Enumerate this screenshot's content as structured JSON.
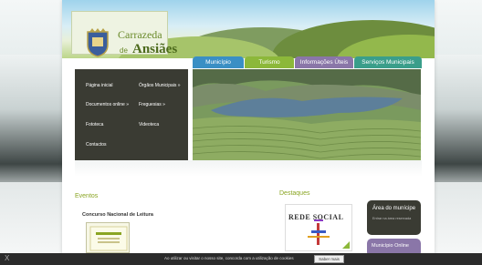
{
  "site": {
    "logo_line1": "Carrazeda",
    "logo_de": "de",
    "logo_line2": "Ansiães"
  },
  "nav": {
    "items": [
      {
        "label": "Município",
        "color": "#3a8fc4"
      },
      {
        "label": "Turismo",
        "color": "#8cb83a"
      },
      {
        "label": "Informações Úteis",
        "color": "#8a76a8"
      },
      {
        "label": "Serviços Municipais",
        "color": "#3a9e8a"
      }
    ]
  },
  "menu": {
    "items": [
      {
        "label": "Página inicial"
      },
      {
        "label": "Órgãos Municipais »"
      },
      {
        "label": "Documentos online »"
      },
      {
        "label": "Freguesias »"
      },
      {
        "label": "Fototeca"
      },
      {
        "label": "Videoteca"
      },
      {
        "label": "Contactos"
      }
    ]
  },
  "eventos": {
    "title": "Eventos",
    "item_title": "Concurso Nacional de Leitura"
  },
  "destaques": {
    "title": "Destaques",
    "rede_social_label": "REDE SOCIAL",
    "area_title": "Área do munícipe",
    "area_sub": "Entrar na área reservada",
    "online_title": "Município Online"
  },
  "cookie": {
    "close": "X",
    "text": "Ao utilizar ou visitar o nosso site, concorda com a utilização de cookies",
    "button": "Saber mais"
  }
}
